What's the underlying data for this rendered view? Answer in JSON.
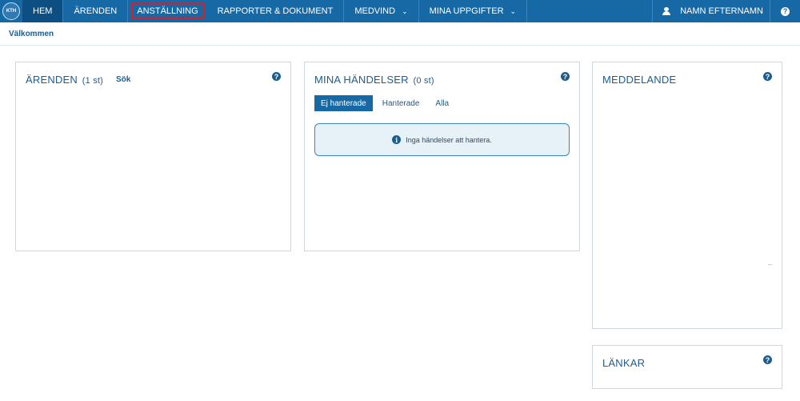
{
  "nav": {
    "logo_text": "KTH",
    "items": [
      {
        "label": "HEM"
      },
      {
        "label": "ÄRENDEN"
      },
      {
        "label": "ANSTÄLLNING"
      },
      {
        "label": "RAPPORTER & DOKUMENT"
      },
      {
        "label": "MEDVIND",
        "caret": "⌄"
      },
      {
        "label": "MINA UPPGIFTER",
        "caret": "⌄"
      }
    ],
    "user_name": "NAMN EFTERNAMN",
    "help_symbol": "?"
  },
  "breadcrumb": {
    "label": "Välkommen"
  },
  "panels": {
    "arenden": {
      "title": "ÄRENDEN",
      "count": "(1 st)",
      "link": "Sök",
      "help_symbol": "?"
    },
    "handelser": {
      "title": "MINA HÄNDELSER",
      "count": "(0 st)",
      "help_symbol": "?",
      "tabs": [
        {
          "label": "Ej hanterade"
        },
        {
          "label": "Hanterade"
        },
        {
          "label": "Alla"
        }
      ],
      "info_icon": "i",
      "info_text": "Inga händelser att hantera."
    },
    "meddelande": {
      "title": "MEDDELANDE",
      "help_symbol": "?",
      "dash": "–"
    },
    "lankar": {
      "title": "LÄNKAR",
      "help_symbol": "?"
    }
  },
  "colors": {
    "nav_bg": "#1769a6",
    "nav_active": "#0d4f82",
    "highlight": "#e01b24",
    "text": "#1d5c8c"
  }
}
